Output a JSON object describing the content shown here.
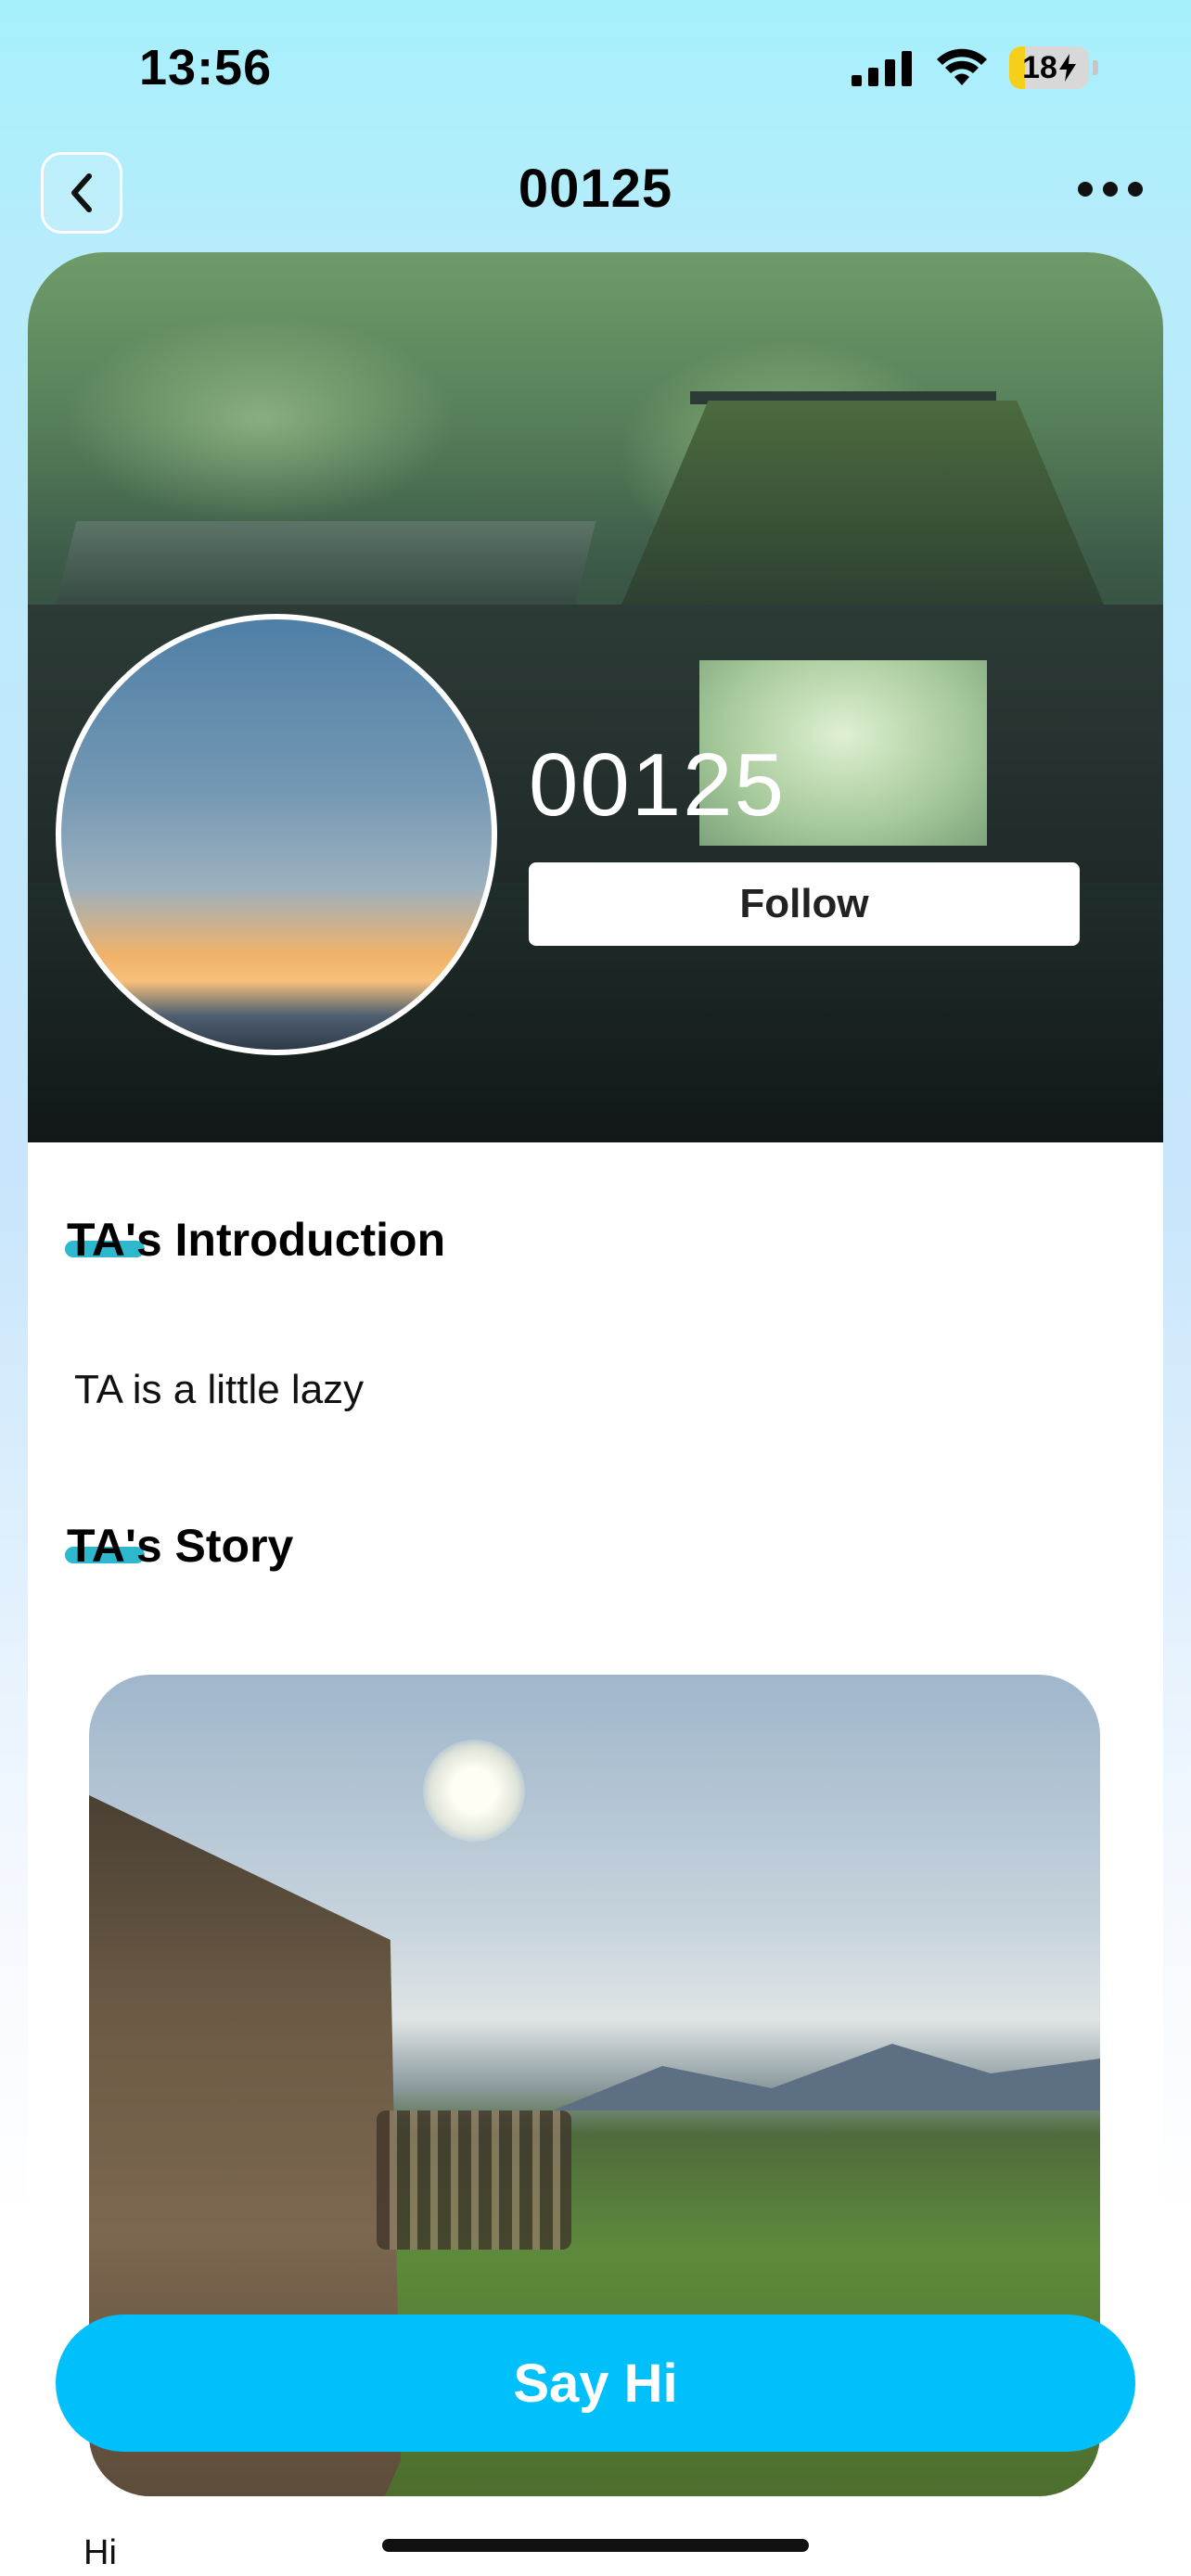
{
  "status_bar": {
    "time": "13:56",
    "battery_level": "18",
    "battery_percent": 18,
    "icons": [
      "cellular-signal-icon",
      "wifi-icon",
      "battery-charging-icon"
    ]
  },
  "nav": {
    "title": "00125",
    "back_icon": "chevron-left-icon",
    "more_icon": "ellipsis-icon"
  },
  "profile": {
    "name": "00125",
    "follow_label": "Follow"
  },
  "introduction": {
    "title": "TA's Introduction",
    "text": "TA is a little lazy"
  },
  "story": {
    "title": "TA's Story",
    "caption": "Hi"
  },
  "actions": {
    "say_hi_label": "Say Hi"
  },
  "colors": {
    "accent": "#00c0fb",
    "title_marker": "#17b0c9",
    "battery": "#f5cf1a"
  }
}
